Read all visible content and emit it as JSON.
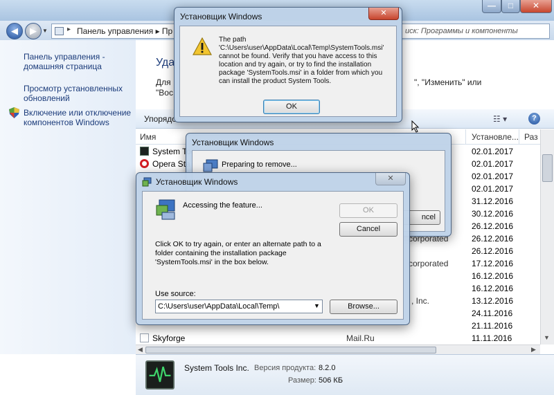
{
  "window": {
    "nav": {
      "back_icon": "arrow-left-icon",
      "forward_icon": "arrow-right-icon"
    },
    "address": "Панель управления  ▸  Пр",
    "search_placeholder": "иск: Программы и компоненты",
    "caption": {
      "min": "—",
      "max": "□",
      "close": "✕"
    }
  },
  "sidebar": {
    "home_link": "Панель управления - домашняя страница",
    "updates_link": "Просмотр установленных обновлений",
    "features_link": "Включение или отключение компонентов Windows"
  },
  "content": {
    "title": "Уда",
    "desc_line1": "Для",
    "desc_line2": "\"Вос",
    "desc_right": "\", \"Изменить\" или"
  },
  "toolbar": {
    "sort": "Упорядо",
    "view": "☷  ▾",
    "help": "?"
  },
  "columns": {
    "name": "Имя",
    "installed": "Установле...",
    "size": "Раз"
  },
  "rows": [
    {
      "name": "System Too",
      "publisher": "",
      "date": "02.01.2017"
    },
    {
      "name": "Opera Sta",
      "publisher": "",
      "date": "02.01.2017"
    },
    {
      "name": "",
      "publisher": "",
      "date": "02.01.2017"
    },
    {
      "name": "",
      "publisher": "",
      "date": "02.01.2017"
    },
    {
      "name": "",
      "publisher": "",
      "date": "31.12.2016"
    },
    {
      "name": "",
      "publisher": "",
      "date": "30.12.2016"
    },
    {
      "name": "",
      "publisher": "",
      "date": "26.12.2016"
    },
    {
      "name": "",
      "publisher": "corporated",
      "date": "26.12.2016"
    },
    {
      "name": "",
      "publisher": "",
      "date": "26.12.2016"
    },
    {
      "name": "",
      "publisher": "corporated",
      "date": "17.12.2016"
    },
    {
      "name": "",
      "publisher": "",
      "date": "16.12.2016"
    },
    {
      "name": "",
      "publisher": "",
      "date": "16.12.2016"
    },
    {
      "name": "",
      "publisher": ", Inc.",
      "date": "13.12.2016"
    },
    {
      "name": "",
      "publisher": "",
      "date": "24.11.2016"
    },
    {
      "name": "",
      "publisher": "",
      "date": "21.11.2016"
    },
    {
      "name": "Skyforge",
      "publisher": "Mail.Ru",
      "date": "11.11.2016"
    }
  ],
  "details": {
    "publisher": "System Tools Inc.",
    "version_label": "Версия продукта:",
    "version": "8.2.0",
    "size_label": "Размер:",
    "size": "506 КБ"
  },
  "error_dialog": {
    "title": "Установщик Windows",
    "message": "The path\n'C:\\Users\\user\\AppData\\Local\\Temp\\SystemTools.msi'\ncannot be found. Verify that you have access to this\nlocation and try again, or try to find the installation\npackage 'SystemTools.msi' in a folder from which you\ncan install the product System Tools.",
    "ok": "OK",
    "close": "✕"
  },
  "remove_dialog": {
    "title": "Установщик Windows",
    "message": "Preparing to remove...",
    "cancel": "ncel"
  },
  "source_dialog": {
    "title": "Установщик Windows",
    "accessing": "Accessing the feature...",
    "ok": "OK",
    "cancel": "Cancel",
    "instructions": "Click OK to try again, or enter an alternate path to a\nfolder containing the installation package\n'SystemTools.msi' in the box below.",
    "source_label": "Use source:",
    "source_value": "C:\\Users\\user\\AppData\\Local\\Temp\\",
    "browse": "Browse...",
    "close": "✕"
  }
}
